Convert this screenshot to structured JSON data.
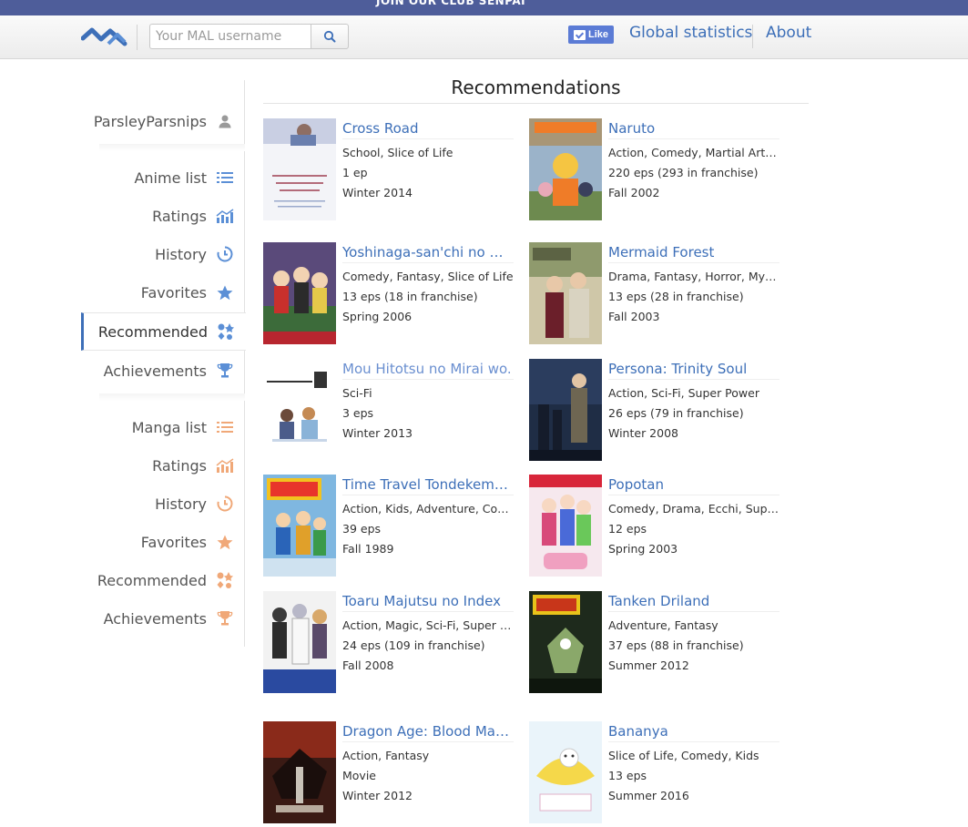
{
  "banner": {
    "text": "JOIN OUR CLUB SENPAI"
  },
  "header": {
    "logo_icon": "anime-stats-logo-icon",
    "search_placeholder": "Your MAL username",
    "search_icon": "search-icon",
    "like_label": "Like",
    "nav": [
      "Global statistics",
      "About"
    ]
  },
  "sidebar": {
    "username": "ParsleyParsnips",
    "anime": [
      {
        "label": "Anime list",
        "icon": "list-icon"
      },
      {
        "label": "Ratings",
        "icon": "chart-icon"
      },
      {
        "label": "History",
        "icon": "history-icon"
      },
      {
        "label": "Favorites",
        "icon": "star-icon"
      },
      {
        "label": "Recommended",
        "icon": "recommend-icon"
      },
      {
        "label": "Achievements",
        "icon": "trophy-icon"
      }
    ],
    "manga": [
      {
        "label": "Manga list",
        "icon": "list-icon"
      },
      {
        "label": "Ratings",
        "icon": "chart-icon"
      },
      {
        "label": "History",
        "icon": "history-icon"
      },
      {
        "label": "Favorites",
        "icon": "star-icon"
      },
      {
        "label": "Recommended",
        "icon": "recommend-icon"
      },
      {
        "label": "Achievements",
        "icon": "trophy-icon"
      }
    ],
    "active": "Recommended",
    "colors": {
      "anime_icon": "#5b8fd6",
      "manga_icon": "#f0a878",
      "active_border": "#3d6fb8"
    }
  },
  "main": {
    "title": "Recommendations",
    "items": [
      {
        "title": "Cross Road",
        "genres": "School, Slice of Life",
        "eps": "1 ep",
        "season": "Winter 2014"
      },
      {
        "title": "Naruto",
        "genres": "Action, Comedy, Martial Arts, S...",
        "eps": "220 eps (293 in franchise)",
        "season": "Fall 2002"
      },
      {
        "title": "Yoshinaga-san'chi no Gar...",
        "genres": "Comedy, Fantasy, Slice of Life",
        "eps": "13 eps (18 in franchise)",
        "season": "Spring 2006"
      },
      {
        "title": "Mermaid Forest",
        "genres": "Drama, Fantasy, Horror, Mystery",
        "eps": "13 eps (28 in franchise)",
        "season": "Fall 2003"
      },
      {
        "title": "Mou Hitotsu no Mirai wo.",
        "genres": "Sci-Fi",
        "eps": "3 eps",
        "season": "Winter 2013",
        "visited": true
      },
      {
        "title": "Persona: Trinity Soul",
        "genres": "Action, Sci-Fi, Super Power",
        "eps": "26 eps (79 in franchise)",
        "season": "Winter 2008"
      },
      {
        "title": "Time Travel Tondekeman!",
        "genres": "Action, Kids, Adventure, Comedy",
        "eps": "39 eps",
        "season": "Fall 1989"
      },
      {
        "title": "Popotan",
        "genres": "Comedy, Drama, Ecchi, Supern...",
        "eps": "12 eps",
        "season": "Spring 2003"
      },
      {
        "title": "Toaru Majutsu no Index",
        "genres": "Action, Magic, Sci-Fi, Super Po...",
        "eps": "24 eps (109 in franchise)",
        "season": "Fall 2008"
      },
      {
        "title": "Tanken Driland",
        "genres": "Adventure, Fantasy",
        "eps": "37 eps (88 in franchise)",
        "season": "Summer 2012"
      },
      {
        "title": "Dragon Age: Blood Mage ...",
        "genres": "Action, Fantasy",
        "eps": "Movie",
        "season": "Winter 2012"
      },
      {
        "title": "Bananya",
        "genres": "Slice of Life, Comedy, Kids",
        "eps": "13 eps",
        "season": "Summer 2016"
      }
    ]
  }
}
